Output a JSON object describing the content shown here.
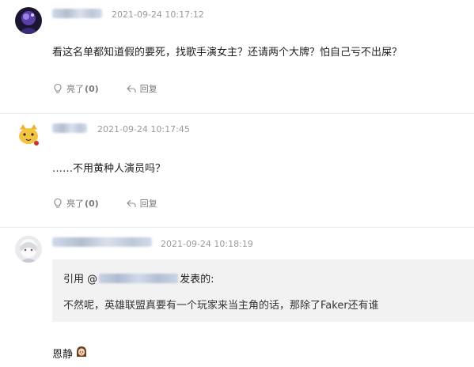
{
  "comments": [
    {
      "time": "2021-09-24 10:17:12",
      "content": "看这名单都知道假的要死，找歌手演女主？还请两个大牌？怕自己亏不出屎？",
      "like_label": "亮了",
      "like_count": "(0)",
      "reply_label": "回复",
      "avatar_icon": "purple-character-avatar"
    },
    {
      "time": "2021-09-24 10:17:45",
      "content": "……不用黄种人演员吗？",
      "like_label": "亮了",
      "like_count": "(0)",
      "reply_label": "回复",
      "avatar_icon": "cat-avatar"
    },
    {
      "time": "2021-09-24 10:18:19",
      "quote_prefix": "引用 @",
      "quote_suffix": "发表的:",
      "quote_body": "不然呢，英雄联盟真要有一个玩家来当主角的话，那除了Faker还有谁",
      "content": "恩静",
      "avatar_icon": "white-hair-anime-avatar",
      "emoji_icon": "girl-emoji-icon"
    }
  ]
}
